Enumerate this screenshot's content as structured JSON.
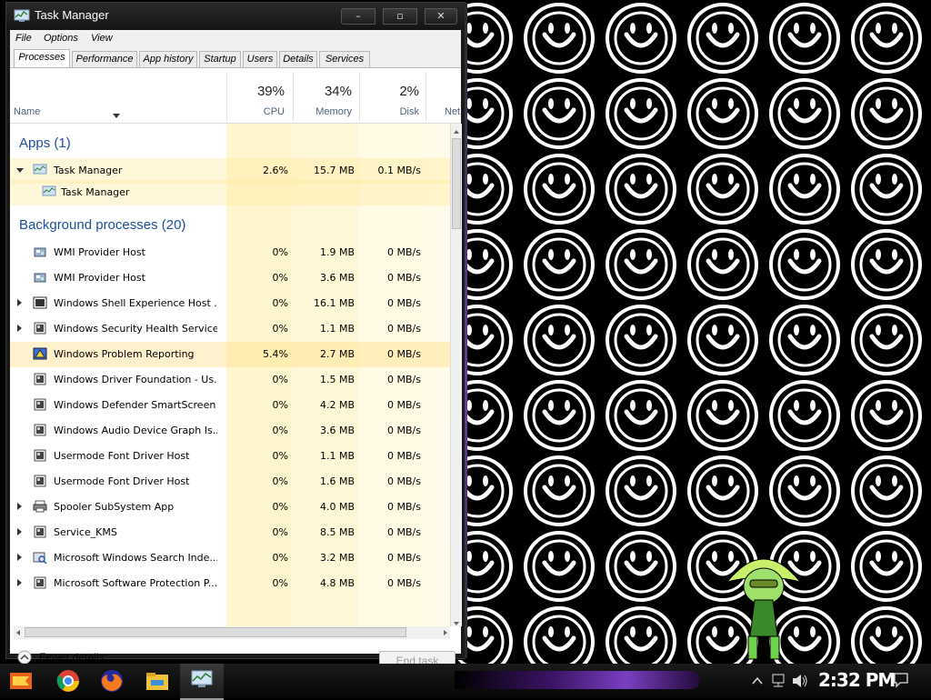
{
  "window": {
    "title": "Task Manager",
    "controls": {
      "minimize": "–",
      "maximize": "▫",
      "close": "✕"
    }
  },
  "menu": [
    "File",
    "Options",
    "View"
  ],
  "tabs": [
    "Processes",
    "Performance",
    "App history",
    "Startup",
    "Users",
    "Details",
    "Services"
  ],
  "active_tab": "Processes",
  "columns": {
    "name": "Name",
    "cpu": {
      "label": "CPU",
      "percent": "39%"
    },
    "memory": {
      "label": "Memory",
      "percent": "34%"
    },
    "disk": {
      "label": "Disk",
      "percent": "2%"
    },
    "network": {
      "label": "Net"
    }
  },
  "groups": {
    "apps": "Apps (1)",
    "background": "Background processes (20)"
  },
  "apps": [
    {
      "name": "Task Manager",
      "cpu": "2.6%",
      "memory": "15.7 MB",
      "disk": "0.1 MB/s",
      "expanded": true,
      "icon": "task-manager-icon"
    },
    {
      "name": "Task Manager",
      "child": true,
      "icon": "task-manager-icon"
    }
  ],
  "background": [
    {
      "name": "WMI Provider Host",
      "cpu": "0%",
      "memory": "1.9 MB",
      "disk": "0 MB/s",
      "expand": false,
      "icon": "wmi-icon"
    },
    {
      "name": "WMI Provider Host",
      "cpu": "0%",
      "memory": "3.6 MB",
      "disk": "0 MB/s",
      "expand": false,
      "icon": "wmi-icon"
    },
    {
      "name": "Windows Shell Experience Host ...",
      "cpu": "0%",
      "memory": "16.1 MB",
      "disk": "0 MB/s",
      "expand": true,
      "icon": "shell-icon"
    },
    {
      "name": "Windows Security Health Service",
      "cpu": "0%",
      "memory": "1.1 MB",
      "disk": "0 MB/s",
      "expand": true,
      "icon": "service-icon"
    },
    {
      "name": "Windows Problem Reporting",
      "cpu": "5.4%",
      "memory": "2.7 MB",
      "disk": "0 MB/s",
      "expand": false,
      "icon": "problem-report-icon"
    },
    {
      "name": "Windows Driver Foundation - Us...",
      "cpu": "0%",
      "memory": "1.5 MB",
      "disk": "0 MB/s",
      "expand": false,
      "icon": "service-icon"
    },
    {
      "name": "Windows Defender SmartScreen",
      "cpu": "0%",
      "memory": "4.2 MB",
      "disk": "0 MB/s",
      "expand": false,
      "icon": "service-icon"
    },
    {
      "name": "Windows Audio Device Graph Is...",
      "cpu": "0%",
      "memory": "3.6 MB",
      "disk": "0 MB/s",
      "expand": false,
      "icon": "service-icon"
    },
    {
      "name": "Usermode Font Driver Host",
      "cpu": "0%",
      "memory": "1.1 MB",
      "disk": "0 MB/s",
      "expand": false,
      "icon": "service-icon"
    },
    {
      "name": "Usermode Font Driver Host",
      "cpu": "0%",
      "memory": "1.6 MB",
      "disk": "0 MB/s",
      "expand": false,
      "icon": "service-icon"
    },
    {
      "name": "Spooler SubSystem App",
      "cpu": "0%",
      "memory": "4.0 MB",
      "disk": "0 MB/s",
      "expand": true,
      "icon": "printer-icon"
    },
    {
      "name": "Service_KMS",
      "cpu": "0%",
      "memory": "8.5 MB",
      "disk": "0 MB/s",
      "expand": true,
      "icon": "service-icon"
    },
    {
      "name": "Microsoft Windows Search Inde...",
      "cpu": "0%",
      "memory": "3.2 MB",
      "disk": "0 MB/s",
      "expand": true,
      "icon": "search-indexer-icon"
    },
    {
      "name": "Microsoft Software Protection P...",
      "cpu": "0%",
      "memory": "4.8 MB",
      "disk": "0 MB/s",
      "expand": true,
      "icon": "service-icon"
    }
  ],
  "footer": {
    "fewer_details": "Fewer details",
    "end_task": "End task"
  },
  "taskbar": {
    "clock": "2:32 PM",
    "icons": [
      "start-icon",
      "chrome-icon",
      "firefox-icon",
      "file-explorer-icon",
      "task-manager-icon"
    ],
    "tray": [
      "chevron-up-icon",
      "network-icon",
      "volume-icon",
      "notification-icon"
    ]
  },
  "colors": {
    "heat_light": "#fff9d6",
    "heat_mid": "#fff1b8",
    "heat_high": "#ffe9a0",
    "group_blue": "#1e4e9c",
    "accent_purple": "#7a3fc2"
  }
}
